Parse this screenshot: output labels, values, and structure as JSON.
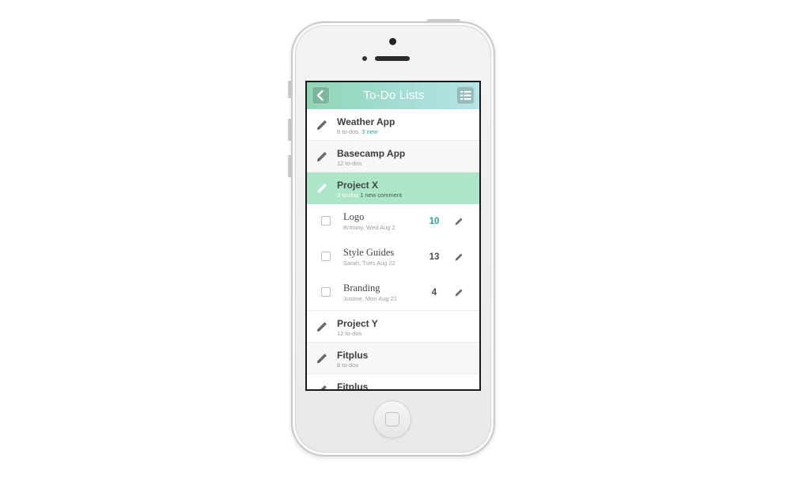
{
  "header": {
    "title": "To-Do Lists",
    "back_icon": "chevron-left-icon",
    "menu_icon": "list-menu-icon"
  },
  "colors": {
    "accent": "#27a9a0",
    "navbar_start": "#8fd6b4",
    "navbar_end": "#b6e3e8",
    "active_row": "#ace5c8"
  },
  "projects_top": [
    {
      "name": "Weather App",
      "todos": "8 to-dos,",
      "extra": "3 new",
      "extra_type": "highlight"
    },
    {
      "name": "Basecamp App",
      "todos": "12 to-dos",
      "extra": "",
      "extra_type": ""
    },
    {
      "name": "Project X",
      "todos": "3 to-dos",
      "extra": "1 new comment",
      "extra_type": "plain",
      "active": true
    }
  ],
  "tasks": [
    {
      "name": "Logo",
      "meta": "Brittany, Wed Aug 2",
      "count": "10",
      "count_highlight": true
    },
    {
      "name": "Style Guides",
      "meta": "Sarah, Tues Aug 22",
      "count": "13",
      "count_highlight": false
    },
    {
      "name": "Branding",
      "meta": "Justine, Mon Aug 21",
      "count": "4",
      "count_highlight": false
    }
  ],
  "projects_bottom": [
    {
      "name": "Project Y",
      "todos": "12 to-dos"
    },
    {
      "name": "Fitplus",
      "todos": "8 to-dos"
    },
    {
      "name": "Fitplus",
      "todos": ""
    }
  ]
}
